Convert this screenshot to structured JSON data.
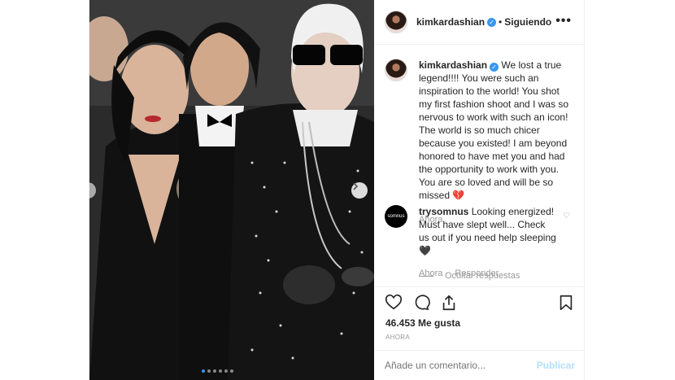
{
  "header": {
    "username": "kimkardashian",
    "separator": "•",
    "follow_status": "Siguiendo",
    "more": "•••"
  },
  "caption": {
    "username": "kimkardashian",
    "text": "We lost a true legend!!!! You were such an inspiration to the world! You shot my first fashion shoot and I was so nervous to work with such an icon! The world is so much chicer because you existed! I am beyond honored to have met you and had the opportunity to work with you. You are so loved and will be so missed 💔",
    "time": "Ahora"
  },
  "comment": {
    "username": "trysomnus",
    "avatar_text": "somnus",
    "text": "Looking energized! Must have slept well... Check us out if you need help sleeping 🖤",
    "time": "Ahora",
    "reply": "Responder",
    "hide_replies": "Ocultar respuestas"
  },
  "stats": {
    "likes": "46.453 Me gusta",
    "time": "AHORA"
  },
  "compose": {
    "placeholder": "Añade un comentario...",
    "publish": "Publicar"
  },
  "colors": {
    "accent": "#3897f0",
    "publish_disabled": "#b2dffc",
    "muted": "#999999"
  },
  "carousel": {
    "slides": 6,
    "active_index": 0
  }
}
